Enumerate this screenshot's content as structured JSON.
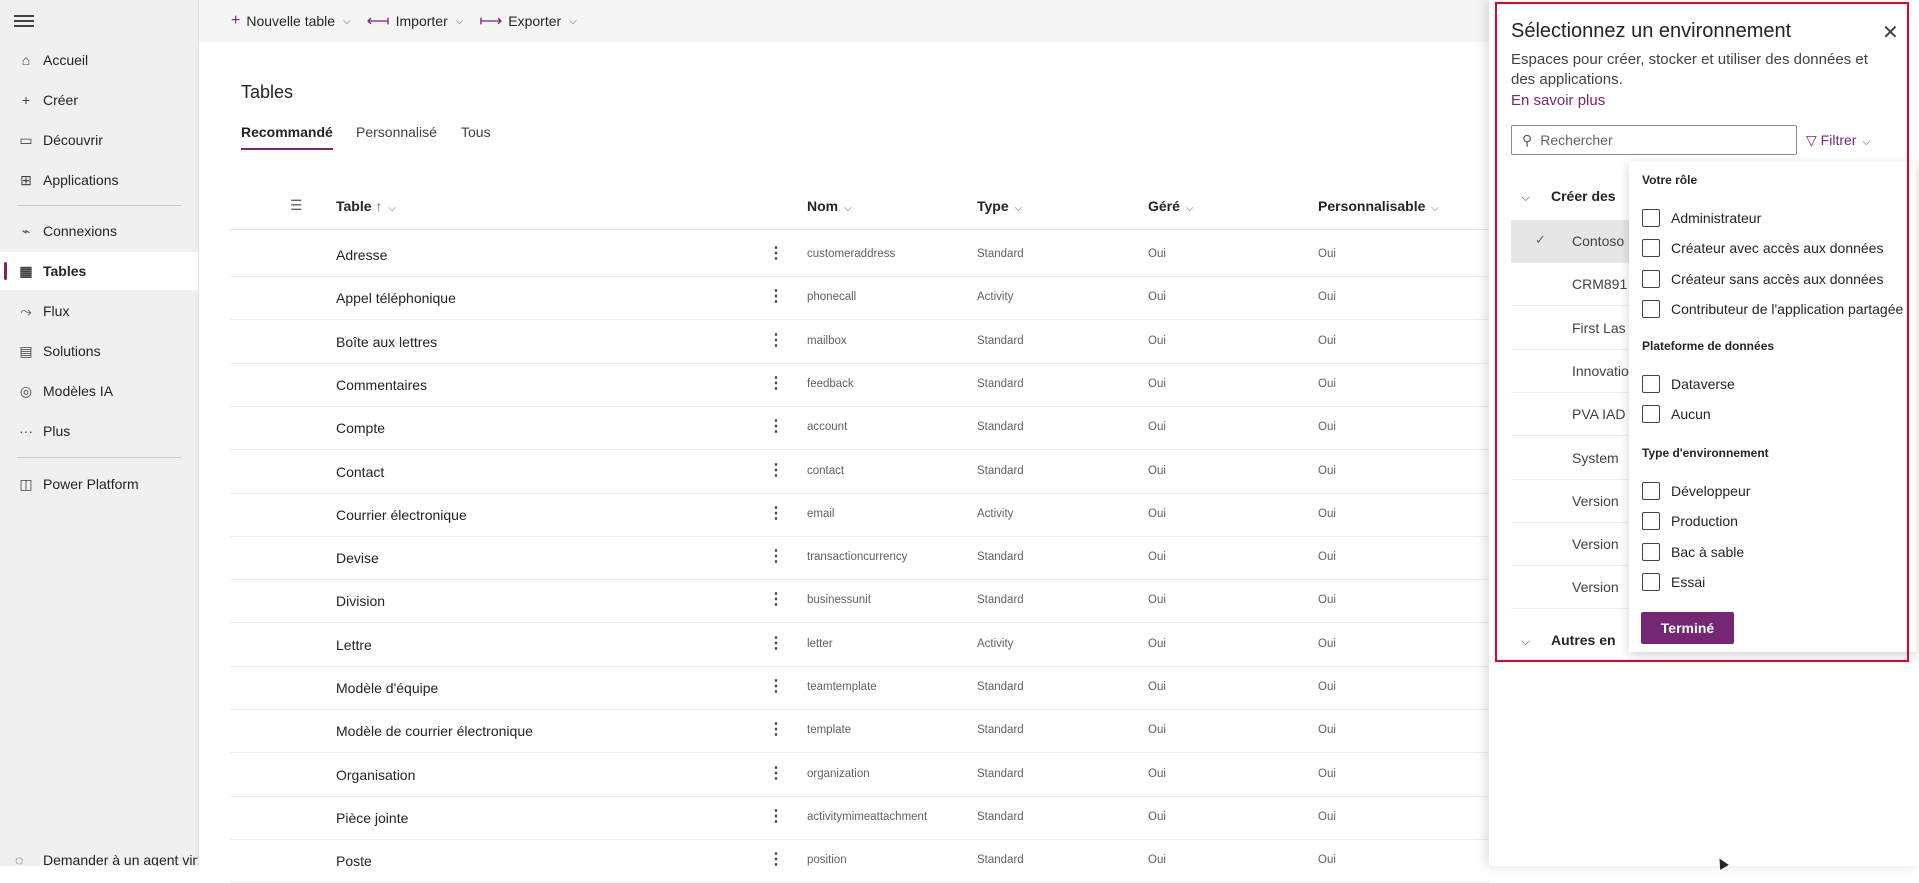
{
  "nav": {
    "items": [
      {
        "label": "Accueil",
        "icon": "home-icon",
        "glyph": "⌂"
      },
      {
        "label": "Créer",
        "icon": "plus-icon",
        "glyph": "+"
      },
      {
        "label": "Découvrir",
        "icon": "book-icon",
        "glyph": "▭"
      },
      {
        "label": "Applications",
        "icon": "apps-icon",
        "glyph": "⊞"
      },
      {
        "label": "Connexions",
        "icon": "plug-icon",
        "glyph": "⌁"
      },
      {
        "label": "Tables",
        "icon": "table-icon",
        "glyph": "▦"
      },
      {
        "label": "Flux",
        "icon": "flow-icon",
        "glyph": "⤳"
      },
      {
        "label": "Solutions",
        "icon": "solutions-icon",
        "glyph": "▤"
      },
      {
        "label": "Modèles IA",
        "icon": "ai-models-icon",
        "glyph": "◎"
      },
      {
        "label": "Plus",
        "icon": "more-icon",
        "glyph": "···"
      },
      {
        "label": "Power Platform",
        "icon": "power-platform-icon",
        "glyph": "◫"
      }
    ],
    "bottom_cut": "Demander à un agent virtuel"
  },
  "cmdbar": {
    "new_table": "Nouvelle table",
    "import": "Importer",
    "export": "Exporter"
  },
  "main": {
    "title": "Tables",
    "tabs": [
      "Recommandé",
      "Personnalisé",
      "Tous"
    ],
    "columns": {
      "table": "Table",
      "sort": "↑",
      "name": "Nom",
      "type": "Type",
      "managed": "Géré",
      "customizable": "Personnalisable"
    },
    "rows": [
      {
        "table": "Adresse",
        "name": "customeraddress",
        "type": "Standard",
        "managed": "Oui",
        "customizable": "Oui"
      },
      {
        "table": "Appel téléphonique",
        "name": "phonecall",
        "type": "Activity",
        "managed": "Oui",
        "customizable": "Oui"
      },
      {
        "table": "Boîte aux lettres",
        "name": "mailbox",
        "type": "Standard",
        "managed": "Oui",
        "customizable": "Oui"
      },
      {
        "table": "Commentaires",
        "name": "feedback",
        "type": "Standard",
        "managed": "Oui",
        "customizable": "Oui"
      },
      {
        "table": "Compte",
        "name": "account",
        "type": "Standard",
        "managed": "Oui",
        "customizable": "Oui"
      },
      {
        "table": "Contact",
        "name": "contact",
        "type": "Standard",
        "managed": "Oui",
        "customizable": "Oui"
      },
      {
        "table": "Courrier électronique",
        "name": "email",
        "type": "Activity",
        "managed": "Oui",
        "customizable": "Oui"
      },
      {
        "table": "Devise",
        "name": "transactioncurrency",
        "type": "Standard",
        "managed": "Oui",
        "customizable": "Oui"
      },
      {
        "table": "Division",
        "name": "businessunit",
        "type": "Standard",
        "managed": "Oui",
        "customizable": "Oui"
      },
      {
        "table": "Lettre",
        "name": "letter",
        "type": "Activity",
        "managed": "Oui",
        "customizable": "Oui"
      },
      {
        "table": "Modèle d'équipe",
        "name": "teamtemplate",
        "type": "Standard",
        "managed": "Oui",
        "customizable": "Oui"
      },
      {
        "table": "Modèle de courrier électronique",
        "name": "template",
        "type": "Standard",
        "managed": "Oui",
        "customizable": "Oui"
      },
      {
        "table": "Organisation",
        "name": "organization",
        "type": "Standard",
        "managed": "Oui",
        "customizable": "Oui"
      },
      {
        "table": "Pièce jointe",
        "name": "activitymimeattachment",
        "type": "Standard",
        "managed": "Oui",
        "customizable": "Oui"
      },
      {
        "table": "Poste",
        "name": "position",
        "type": "Standard",
        "managed": "Oui",
        "customizable": "Oui"
      }
    ]
  },
  "env_panel": {
    "title": "Sélectionnez un environnement",
    "description": "Espaces pour créer, stocker et utiliser des données et des applications.",
    "learn_more": "En savoir plus",
    "search_placeholder": "Rechercher",
    "filter_label": "Filtrer",
    "group_create": "Créer des",
    "group_other": "Autres en",
    "environments": [
      "Contoso",
      "CRM891",
      "First Las",
      "Innovatio",
      "PVA IAD",
      "System",
      "Version",
      "Version",
      "Version"
    ],
    "selected_index": 0
  },
  "filter_dropdown": {
    "sections": [
      {
        "title": "Votre rôle",
        "options": [
          "Administrateur",
          "Créateur avec accès aux données",
          "Créateur sans accès aux données",
          "Contributeur de l'application partagée"
        ]
      },
      {
        "title": "Plateforme de données",
        "options": [
          "Dataverse",
          "Aucun"
        ]
      },
      {
        "title": "Type d'environnement",
        "options": [
          "Développeur",
          "Production",
          "Bac à sable",
          "Essai"
        ]
      }
    ],
    "done_label": "Terminé"
  },
  "colors": {
    "accent": "#742774",
    "highlight": "#e3002b",
    "nav_bg": "#f0f0f0"
  }
}
